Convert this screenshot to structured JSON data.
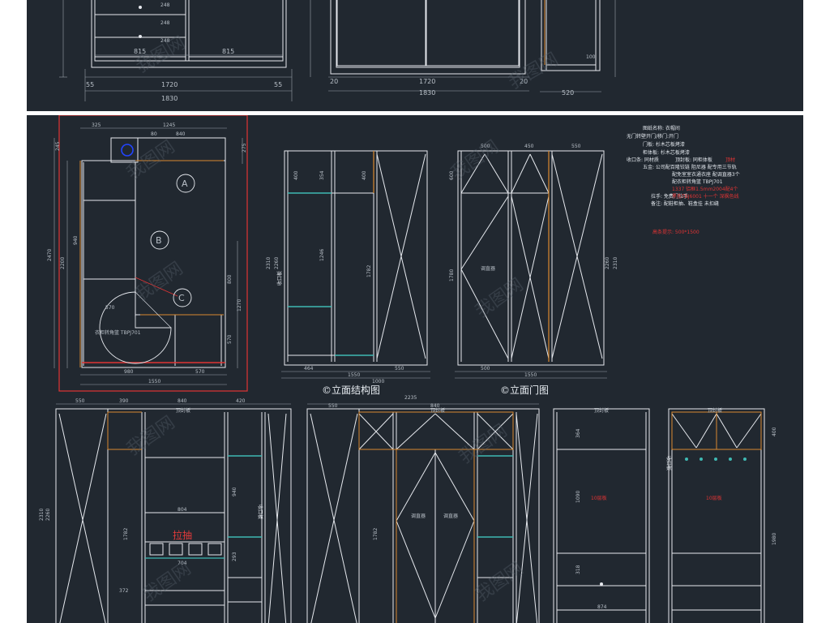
{
  "colors": {
    "background": "#212830",
    "line": "#e6e9ee",
    "dimension": "#b9c0c8",
    "wood": "#d9892f",
    "red": "#e03434",
    "blue": "#2244ff",
    "cyan": "#3fb9b3"
  },
  "top_section": {
    "left_dims": [
      "815",
      "815",
      "55",
      "1720",
      "55",
      "1830"
    ],
    "drawer_dims": [
      "248",
      "248",
      "248"
    ],
    "middle_dims": [
      "20",
      "1720",
      "20",
      "1830"
    ],
    "right_dims": [
      "100",
      "520"
    ]
  },
  "plan": {
    "top_dims": [
      "325",
      "1245",
      "80",
      "840"
    ],
    "left_dims": [
      "245",
      "2470",
      "2200",
      "940"
    ],
    "right_dims": [
      "275",
      "800",
      "1270",
      "570"
    ],
    "bottom_dims": [
      "980",
      "570",
      "1550"
    ],
    "zone_a": "A",
    "zone_b": "B",
    "zone_c": "C",
    "corner_label": "衣柜转角篮 TBPJ701",
    "arc_dim": "570"
  },
  "elevation_structure": {
    "heights": [
      "2310",
      "2260",
      "1246",
      "1782"
    ],
    "shelf_dims": [
      "354",
      "400",
      "400"
    ],
    "side_label": "收口板",
    "bottom_dims": [
      "464",
      "1550",
      "1000",
      "550"
    ],
    "caption": "立面结构图"
  },
  "elevation_door": {
    "top_dims": [
      "500",
      "450",
      "550"
    ],
    "heights": [
      "1780",
      "600",
      "2260",
      "2310"
    ],
    "bottom_dims": [
      "500",
      "1550"
    ],
    "label": "调直器",
    "caption": "立面门图"
  },
  "notes": {
    "lines": [
      "图纸名称: 衣帽间",
      "无门转壁开门/移门:开门",
      "门板: 杉木芯板烤漆",
      "柜体板: 杉木芯板烤漆",
      "收口条: 同材质",
      "顶封板: 同柜体板",
      "五金: 公司配百隆铰链   阻尼器  配专用三节轨",
      "配免室室衣通衣座   配调直器3个",
      "配衣柜转角篮 TBPJ701",
      "拉手: 免费门拉手",
      "备注: 配鞋柜抽、鞋盒挂 未扣缝"
    ],
    "red_lines": [
      "1337 铝框1.5mm2004配4个",
      "黑色TBJ6001  十一个  深枫色线",
      "高条提示: 500*1500"
    ],
    "red_heading": "顶材"
  },
  "bottom_section": {
    "top_dims": [
      "550",
      "390",
      "840",
      "420",
      "550",
      "2235",
      "840"
    ],
    "heights": [
      "2310",
      "2260",
      "1782",
      "940",
      "804",
      "372",
      "704",
      "293"
    ],
    "drawer_label": "拉抽",
    "top_label": "顶封板",
    "side_labels": [
      "收口板",
      "收口板"
    ],
    "red_labels": [
      "10层板",
      "10层板"
    ],
    "door_labels": [
      "调直器",
      "调直器"
    ],
    "right_heights": [
      "1090",
      "318",
      "874",
      "364",
      "1980",
      "400"
    ]
  },
  "watermark": "我图网"
}
